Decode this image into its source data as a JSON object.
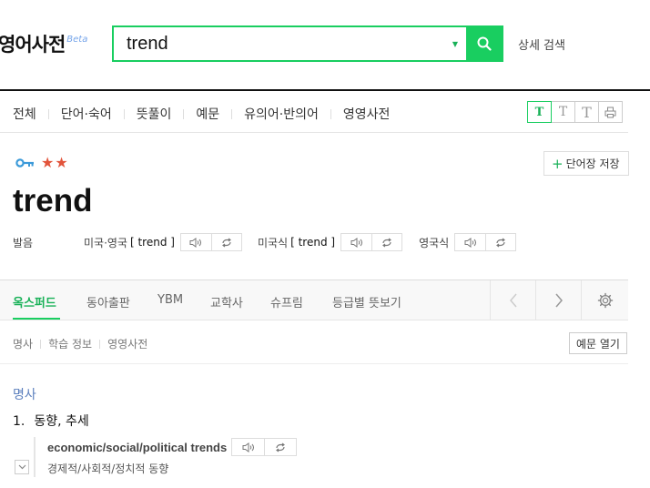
{
  "header": {
    "logo": "영어사전",
    "beta": "Beta",
    "search_value": "trend",
    "detail_search": "상세 검색"
  },
  "nav": {
    "items": [
      "전체",
      "단어·숙어",
      "뜻풀이",
      "예문",
      "유의어·반의어",
      "영영사전"
    ],
    "font_sizes": [
      "T",
      "T",
      "T"
    ]
  },
  "entry": {
    "star_rating": "★★",
    "save_label": "단어장 저장",
    "headword": "trend",
    "pron_label": "발음",
    "pronunciations": [
      {
        "region": "미국·영국",
        "phonetic": "[ trend ]"
      },
      {
        "region": "미국식",
        "phonetic": "[ trend ]"
      },
      {
        "region": "영국식",
        "phonetic": ""
      }
    ]
  },
  "dict_tabs": [
    "옥스퍼드",
    "동아출판",
    "YBM",
    "교학사",
    "슈프림",
    "등급별 뜻보기"
  ],
  "section_tabs": [
    "명사",
    "학습 정보",
    "영영사전"
  ],
  "example_open": "예문 열기",
  "meaning": {
    "pos": "명사",
    "number": "1.",
    "text": "동향, 추세",
    "example_en": "economic/social/political trends",
    "example_ko": "경제적/사회적/정치적 동향"
  },
  "colors": {
    "accent": "#19ce60",
    "star": "#e2543b",
    "pos": "#5b7fbd"
  }
}
